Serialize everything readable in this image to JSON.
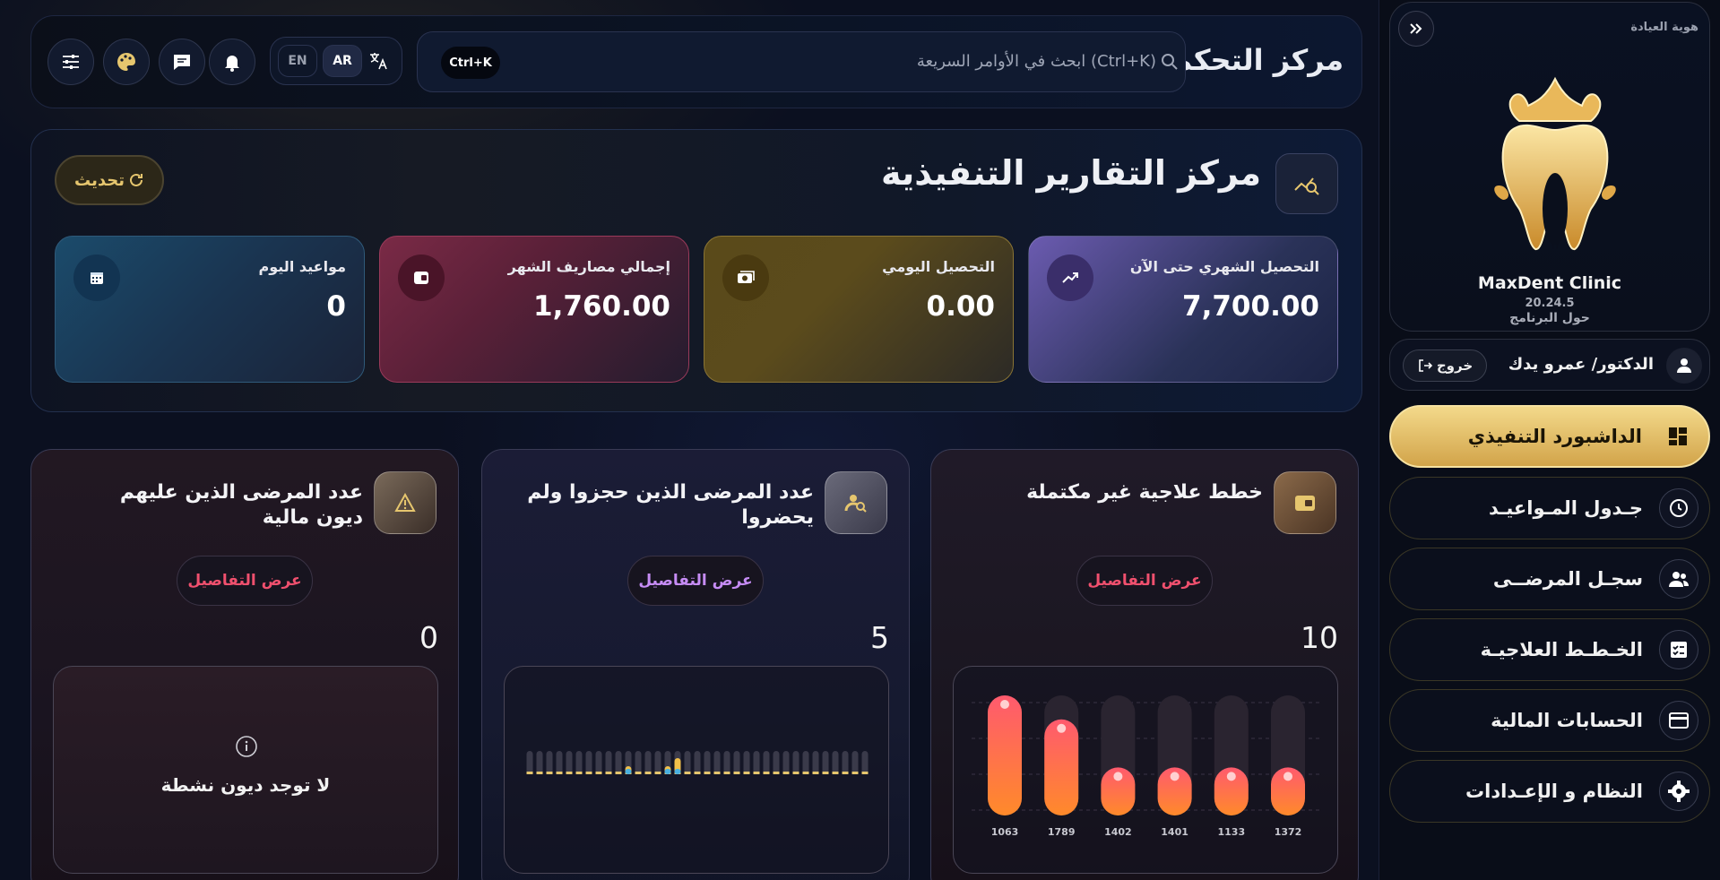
{
  "header": {
    "title": "مركز التحكم",
    "search_placeholder": "ابحث في الأوامر السريعة (Ctrl+K)",
    "shortcut": "Ctrl+K",
    "lang_en": "EN",
    "lang_ar": "AR"
  },
  "sidebar": {
    "brand_identity_label": "هوية العيادة",
    "clinic_name": "MaxDent Clinic",
    "version": "20.24.5",
    "about": "حول البرنامج",
    "user_name": "الدكتور/ عمرو يدك",
    "logout": "خروج",
    "items": [
      {
        "label": "الداشبورد التنفيذي",
        "icon": "dashboard-icon",
        "active": true
      },
      {
        "label": "جـدول المـواعيـد",
        "icon": "clock-icon",
        "active": false
      },
      {
        "label": "سجـل المرضــى",
        "icon": "users-icon",
        "active": false
      },
      {
        "label": "الخـطـط العلاجيـة",
        "icon": "checklist-icon",
        "active": false
      },
      {
        "label": "الحسابات المالية",
        "icon": "credit-card-icon",
        "active": false
      },
      {
        "label": "النظام و الإعـدادات",
        "icon": "gear-icon",
        "active": false
      }
    ]
  },
  "reports": {
    "title": "مركز التقارير التنفيذية",
    "refresh": "تحديث",
    "stats": [
      {
        "label": "التحصيل الشهري حتى الآن",
        "value": "7,700.00",
        "icon": "trend-up-icon"
      },
      {
        "label": "التحصيل اليومي",
        "value": "0.00",
        "icon": "cash-icon"
      },
      {
        "label": "إجمالي مصاريف الشهر",
        "value": "1,760.00",
        "icon": "wallet-icon"
      },
      {
        "label": "مواعيد اليوم",
        "value": "0",
        "icon": "calendar-icon"
      }
    ]
  },
  "cards": [
    {
      "title": "خطط علاجية غير مكتملة",
      "details": "عرض التفاصيل",
      "count": "10",
      "icon": "wallet-icon"
    },
    {
      "title": "عدد المرضى الذين حجزوا ولم يحضروا",
      "details": "عرض التفاصيل",
      "count": "5",
      "icon": "user-search-icon"
    },
    {
      "title": "عدد المرضى الذين عليهم ديون مالية",
      "details": "عرض التفاصيل",
      "count": "0",
      "icon": "warning-icon",
      "empty": "لا توجد ديون نشطة"
    }
  ],
  "colors": {
    "gold": "#e6c66e",
    "accent_red": "#f0506e",
    "accent_purple": "#c68cf5"
  },
  "chart_data": [
    {
      "type": "bar",
      "categories": [
        "1063",
        "1789",
        "1402",
        "1401",
        "1133",
        "1372"
      ],
      "values": [
        10,
        8,
        4,
        4,
        4,
        4
      ]
    },
    {
      "type": "bar",
      "categories": [],
      "values": [
        0,
        0,
        0,
        0,
        0,
        0,
        0,
        0,
        0,
        0,
        1,
        0,
        0,
        0,
        1,
        2,
        0,
        0,
        0,
        0,
        0,
        0,
        0,
        0,
        0,
        0,
        0,
        0,
        0,
        0,
        0,
        0,
        0,
        0,
        0
      ]
    }
  ]
}
